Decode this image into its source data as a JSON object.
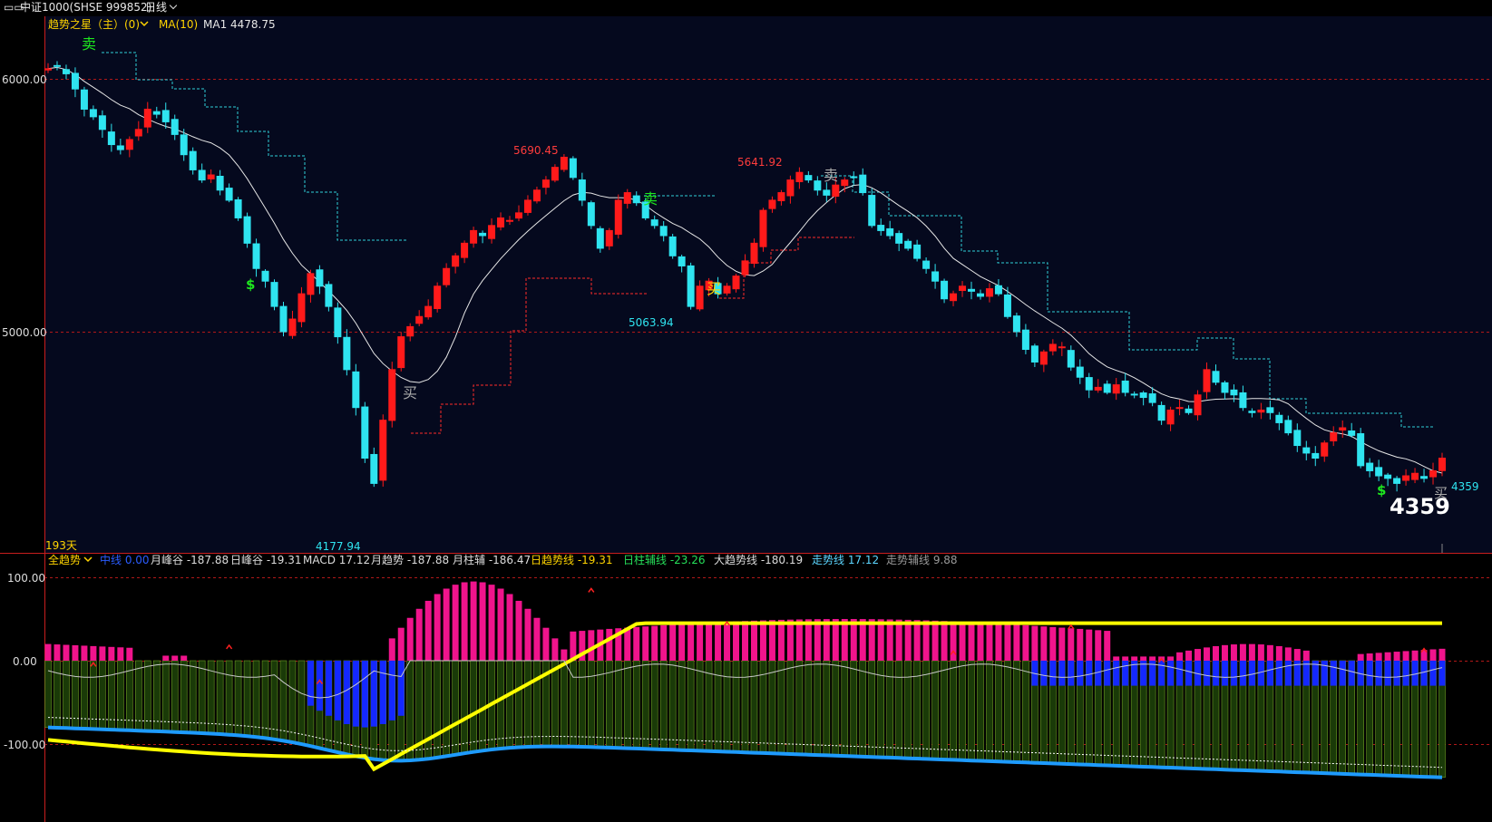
{
  "window": {
    "title": "中证1000(SHSE 999852)",
    "period": "日线"
  },
  "main_panel": {
    "indicator_label": "趋势之星（主）(0)",
    "ma_label": "MA(10)",
    "ma_value_label": "MA1 4478.75",
    "days_label": "193天",
    "y_ticks": [
      "6000.00",
      "5000.00"
    ],
    "signals": {
      "sell": "卖",
      "buy": "买",
      "dollar": "$"
    },
    "annotations": {
      "high1": "5690.45",
      "high2": "5641.92",
      "low1": "5063.94",
      "low_min": "4177.94",
      "last_small": "4359",
      "last_big": "4359"
    }
  },
  "sub_panel": {
    "mode_label": "全趋势",
    "items": [
      {
        "label": "中线 0.00",
        "color": "#2a5cff"
      },
      {
        "label": "月峰谷 -187.88",
        "color": "#dddddd"
      },
      {
        "label": "日峰谷 -19.31",
        "color": "#dddddd"
      },
      {
        "label": "MACD 17.12",
        "color": "#dddddd"
      },
      {
        "label": "月趋势 -187.88",
        "color": "#dddddd"
      },
      {
        "label": "月柱辅 -186.47",
        "color": "#dddddd"
      },
      {
        "label": "日趋势线 -19.31",
        "color": "#ffd400"
      },
      {
        "label": "日柱辅线 -23.26",
        "color": "#26e05a"
      },
      {
        "label": "大趋势线 -180.19",
        "color": "#dddddd"
      },
      {
        "label": "走势线 17.12",
        "color": "#5cd6ff"
      },
      {
        "label": "走势辅线 9.88",
        "color": "#9a9a9a"
      }
    ],
    "y_ticks": [
      "100.00",
      "0.00",
      "-100.00"
    ]
  },
  "colors": {
    "up": "#ff1a1a",
    "down": "#2fe4f0",
    "ma": "#e6e6e6",
    "grid": "#b01818",
    "pink": "#f0148c",
    "olive": "#6e9a24",
    "blue": "#1428ff",
    "yellow": "#ffff00",
    "lightblue": "#1e9bff"
  },
  "chart_data": {
    "type": "candlestick",
    "title": "中证1000(SHSE 999852) 日线",
    "ylim": [
      4100,
      6100
    ],
    "close_series": [
      6040,
      6050,
      6020,
      5960,
      5880,
      5850,
      5800,
      5740,
      5720,
      5760,
      5800,
      5880,
      5860,
      5830,
      5780,
      5700,
      5640,
      5600,
      5620,
      5560,
      5520,
      5450,
      5350,
      5250,
      5200,
      5100,
      5000,
      5050,
      5150,
      5230,
      5180,
      5100,
      4980,
      4850,
      4700,
      4500,
      4400,
      4650,
      4850,
      4980,
      5020,
      5060,
      5100,
      5180,
      5250,
      5300,
      5350,
      5400,
      5380,
      5420,
      5450,
      5440,
      5470,
      5520,
      5560,
      5600,
      5650,
      5690,
      5610,
      5520,
      5420,
      5330,
      5400,
      5520,
      5550,
      5510,
      5450,
      5420,
      5380,
      5300,
      5260,
      5100,
      5180,
      5200,
      5150,
      5180,
      5220,
      5280,
      5350,
      5480,
      5520,
      5550,
      5600,
      5630,
      5600,
      5560,
      5540,
      5580,
      5600,
      5610,
      5550,
      5420,
      5400,
      5380,
      5350,
      5330,
      5290,
      5250,
      5200,
      5130,
      5150,
      5180,
      5160,
      5140,
      5170,
      5150,
      5060,
      5000,
      4930,
      4880,
      4920,
      4950,
      4940,
      4860,
      4820,
      4770,
      4780,
      4760,
      4790,
      4760,
      4750,
      4740,
      4720,
      4650,
      4690,
      4700,
      4680,
      4750,
      4850,
      4800,
      4760,
      4750,
      4700,
      4680,
      4690,
      4680,
      4640,
      4600,
      4550,
      4520,
      4500,
      4560,
      4600,
      4620,
      4590,
      4470,
      4450,
      4430,
      4420,
      4400,
      4430,
      4440,
      4420,
      4450,
      4500
    ]
  }
}
